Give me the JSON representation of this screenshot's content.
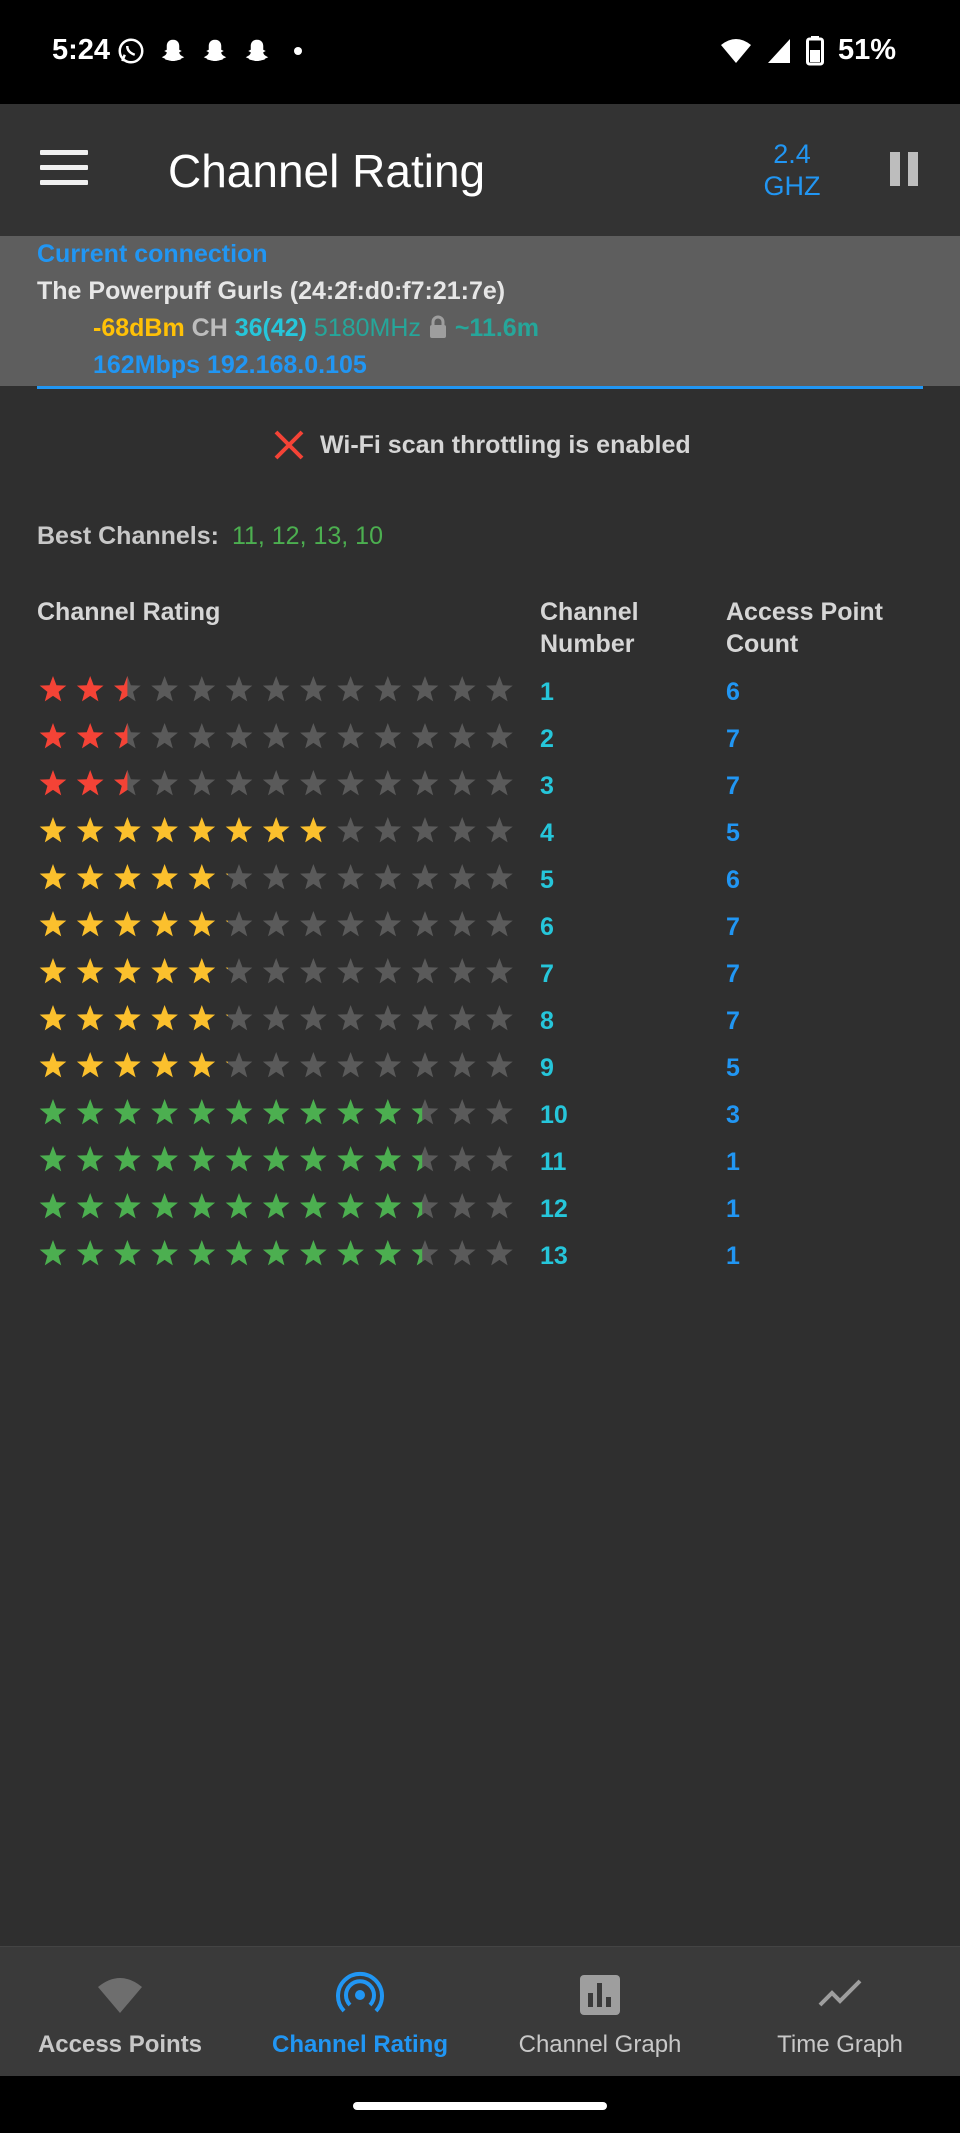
{
  "status_bar": {
    "time": "5:24",
    "battery": "51%"
  },
  "app_bar": {
    "title": "Channel Rating",
    "band": "2.4 GHZ",
    "band_line1": "2.4",
    "band_line2": "GHZ"
  },
  "connection": {
    "heading": "Current connection",
    "ssid_line": "The Powerpuff Gurls (24:2f:d0:f7:21:7e)",
    "signal": "-68dBm",
    "ch_label": "CH",
    "channel": "36(42)",
    "frequency": "5180MHz",
    "distance": "~11.6m",
    "speed": "162Mbps",
    "ip": "192.168.0.105"
  },
  "throttle_message": "Wi-Fi scan throttling is enabled",
  "best_channels": {
    "label": "Best Channels:",
    "value": "11, 12, 13, 10"
  },
  "table": {
    "headers": [
      "Channel Rating",
      "Channel Number",
      "Access Point Count"
    ],
    "header_channel_l1": "Channel",
    "header_channel_l2": "Number",
    "header_ap_l1": "Access Point",
    "header_ap_l2": "Count",
    "rows": [
      {
        "channel": "1",
        "count": "6",
        "rating": 2.5,
        "color": "#f44336"
      },
      {
        "channel": "2",
        "count": "7",
        "rating": 2.5,
        "color": "#f44336"
      },
      {
        "channel": "3",
        "count": "7",
        "rating": 2.5,
        "color": "#f44336"
      },
      {
        "channel": "4",
        "count": "5",
        "rating": 8,
        "color": "#fbc02d"
      },
      {
        "channel": "5",
        "count": "6",
        "rating": 5.1,
        "color": "#fbc02d"
      },
      {
        "channel": "6",
        "count": "7",
        "rating": 5.1,
        "color": "#fbc02d"
      },
      {
        "channel": "7",
        "count": "7",
        "rating": 5.1,
        "color": "#fbc02d"
      },
      {
        "channel": "8",
        "count": "7",
        "rating": 5.1,
        "color": "#fbc02d"
      },
      {
        "channel": "9",
        "count": "5",
        "rating": 5.1,
        "color": "#fbc02d"
      },
      {
        "channel": "10",
        "count": "3",
        "rating": 10.4,
        "color": "#4caf50"
      },
      {
        "channel": "11",
        "count": "1",
        "rating": 10.4,
        "color": "#4caf50"
      },
      {
        "channel": "12",
        "count": "1",
        "rating": 10.4,
        "color": "#4caf50"
      },
      {
        "channel": "13",
        "count": "1",
        "rating": 10.4,
        "color": "#4caf50"
      }
    ],
    "max_stars": 13
  },
  "bottom_nav": [
    {
      "label": "Access Points",
      "icon": "wifi-icon",
      "active": false
    },
    {
      "label": "Channel Rating",
      "icon": "radar-icon",
      "active": true
    },
    {
      "label": "Channel Graph",
      "icon": "bar-chart-icon",
      "active": false
    },
    {
      "label": "Time Graph",
      "icon": "line-graph-icon",
      "active": false
    }
  ],
  "colors": {
    "accent": "#2196f3",
    "channel_text": "#26c6da",
    "empty_star": "#5a5a5a"
  }
}
